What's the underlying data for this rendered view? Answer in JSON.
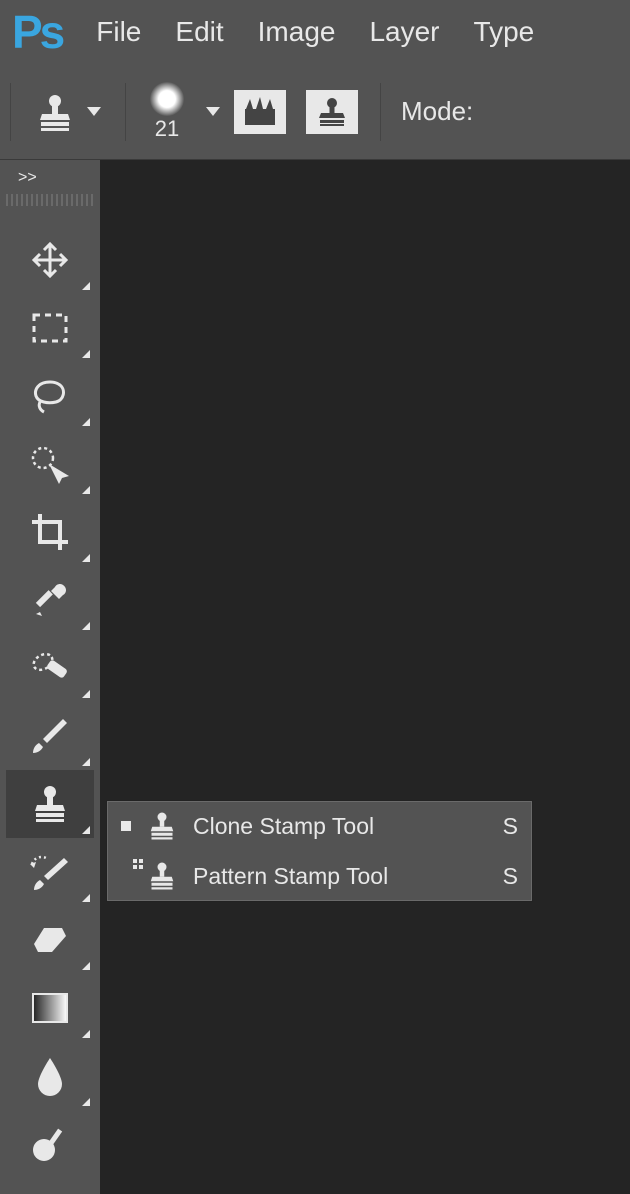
{
  "menubar": {
    "items": [
      "File",
      "Edit",
      "Image",
      "Layer",
      "Type"
    ]
  },
  "optionsbar": {
    "brush_size": "21",
    "mode_label": "Mode:"
  },
  "tools_column": {
    "expand_label": ">>"
  },
  "flyout": {
    "items": [
      {
        "label": "Clone Stamp Tool",
        "shortcut": "S",
        "active": true
      },
      {
        "label": "Pattern Stamp Tool",
        "shortcut": "S",
        "active": false
      }
    ]
  }
}
